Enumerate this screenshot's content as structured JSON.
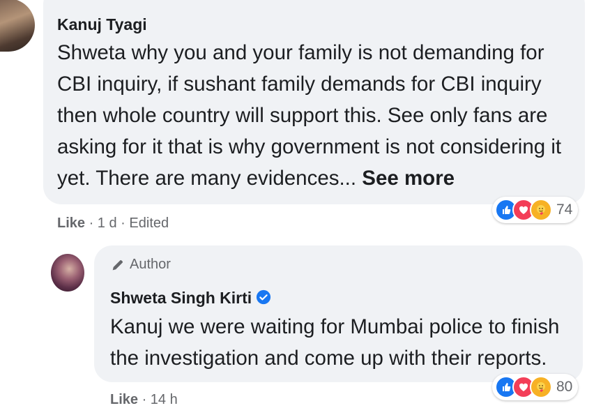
{
  "comment1": {
    "author": "Kanuj Tyagi",
    "lines": [
      "Shweta why you and your family is not demanding for",
      "CBI inquiry, if sushant family demands for CBI inquiry",
      "then whole country will support this. See only fans are",
      "asking for it that is why government is not considering it",
      "yet. There are many evidences..."
    ],
    "see_more": "See more",
    "reaction_count": "74",
    "like": "Like",
    "time": "· 1 d ·",
    "edited": "Edited"
  },
  "reply": {
    "badge": "Author",
    "author": "Shweta Singh Kirti",
    "lines": [
      "Kanuj we were waiting for Mumbai police to finish",
      "the investigation and come up with their reports."
    ],
    "reaction_count": "80",
    "like": "Like",
    "time": "· 14 h"
  },
  "icons": [
    "pencil-icon",
    "verified-badge-icon",
    "like-reaction-icon",
    "love-reaction-icon",
    "care-reaction-icon"
  ],
  "colors": {
    "bubble": "#f0f2f5",
    "like": "#1877f2",
    "love": "#f33e58",
    "care": "#f7b125",
    "meta": "#65676b"
  }
}
